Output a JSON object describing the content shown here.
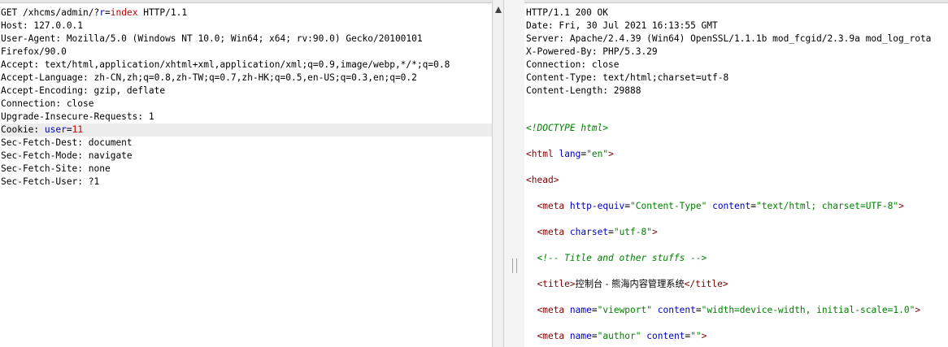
{
  "request": {
    "method": "GET",
    "path": "/xhcms/admin/?",
    "param_name": "r",
    "param_value": "index",
    "protocol": "HTTP/1.1",
    "headers": [
      "Host: 127.0.0.1",
      "User-Agent: Mozilla/5.0 (Windows NT 10.0; Win64; x64; rv:90.0) Gecko/20100101",
      "Firefox/90.0",
      "Accept: text/html,application/xhtml+xml,application/xml;q=0.9,image/webp,*/*;q=0.8",
      "Accept-Language: zh-CN,zh;q=0.8,zh-TW;q=0.7,zh-HK;q=0.5,en-US;q=0.3,en;q=0.2",
      "Accept-Encoding: gzip, deflate",
      "Connection: close",
      "Upgrade-Insecure-Requests: 1"
    ],
    "cookie_label": "Cookie: ",
    "cookie_name": "user",
    "cookie_value": "11",
    "headers_after": [
      "Sec-Fetch-Dest: document",
      "Sec-Fetch-Mode: navigate",
      "Sec-Fetch-Site: none",
      "Sec-Fetch-User: ?1"
    ]
  },
  "response": {
    "headers": [
      "HTTP/1.1 200 OK",
      "Date: Fri, 30 Jul 2021 16:13:55 GMT",
      "Server: Apache/2.4.39 (Win64) OpenSSL/1.1.1b mod_fcgid/2.3.9a mod_log_rota",
      "X-Powered-By: PHP/5.3.29",
      "Connection: close",
      "Content-Type: text/html;charset=utf-8",
      "Content-Length: 29888"
    ],
    "body": {
      "doctype": "<!DOCTYPE html>",
      "html_tag": "html",
      "html_attr": "lang",
      "html_val": "\"en\"",
      "head_tag": "head",
      "meta1_attr1": "http-equiv",
      "meta1_val1": "\"Content-Type\"",
      "meta1_attr2": "content",
      "meta1_val2": "\"text/html; charset=UTF-8\"",
      "meta2_attr": "charset",
      "meta2_val": "\"utf-8\"",
      "comment": "<!-- Title and other stuffs -->",
      "title_tag": "title",
      "title_text": "控制台 - 熊海内容管理系统",
      "meta3_attr1": "name",
      "meta3_val1": "\"viewport\"",
      "meta3_attr2": "content",
      "meta3_val2": "\"width=device-width, initial-scale=1.0\"",
      "meta4_attr1": "name",
      "meta4_val1": "\"author\"",
      "meta4_attr2": "content",
      "meta4_val2": "\"\""
    }
  },
  "icons": {
    "scroll_up": "scroll-up-arrow-icon",
    "splitter": "splitter-grip-icon"
  },
  "colors": {
    "tag": "#800000",
    "attribute": "#0000c0",
    "value": "#008000",
    "highlight": "#ececec"
  }
}
